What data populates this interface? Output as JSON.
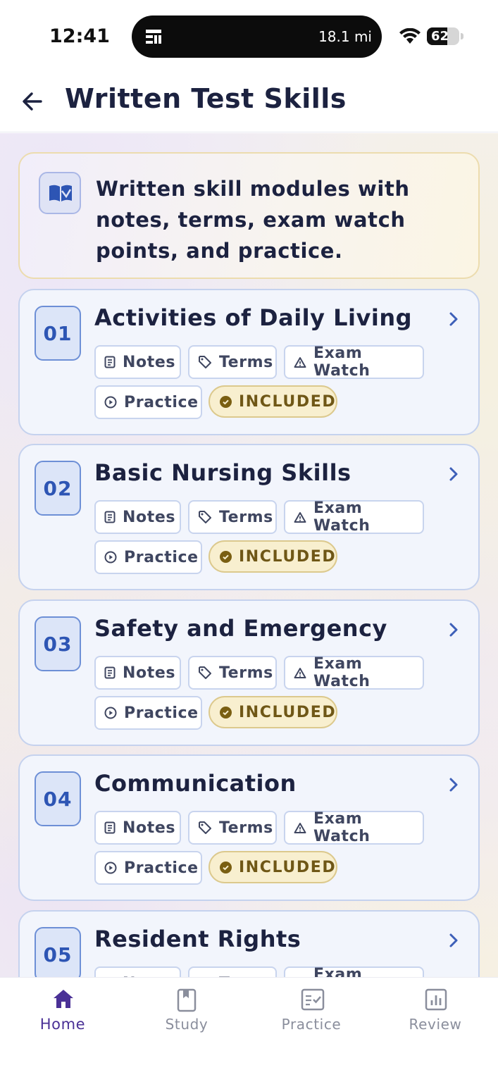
{
  "status_bar": {
    "time": "12:41",
    "distance": "18.1 mi",
    "battery": "62",
    "battery_level_percent": 62
  },
  "header": {
    "title": "Written Test Skills",
    "back_icon": "arrow-left-icon"
  },
  "intro": {
    "icon": "book-open-icon",
    "text": "Written skill modules with notes, terms, exam watch points, and practice."
  },
  "tag_labels": {
    "notes": "Notes",
    "terms": "Terms",
    "exam_watch": "Exam Watch",
    "practice": "Practice",
    "included": "INCLUDED"
  },
  "modules": [
    {
      "number": "01",
      "title": "Activities of Daily Living"
    },
    {
      "number": "02",
      "title": "Basic Nursing Skills"
    },
    {
      "number": "03",
      "title": "Safety and Emergency"
    },
    {
      "number": "04",
      "title": "Communication"
    },
    {
      "number": "05",
      "title": "Resident Rights"
    }
  ],
  "tabs": [
    {
      "label": "Home",
      "icon": "home-icon",
      "active": true
    },
    {
      "label": "Study",
      "icon": "bookmark-book-icon",
      "active": false
    },
    {
      "label": "Practice",
      "icon": "checklist-icon",
      "active": false
    },
    {
      "label": "Review",
      "icon": "bar-chart-icon",
      "active": false
    }
  ],
  "colors": {
    "accent": "#4a3196",
    "number_blue": "#2d55b4",
    "included_gold": "#6f5716",
    "title_text": "#1c2240"
  }
}
